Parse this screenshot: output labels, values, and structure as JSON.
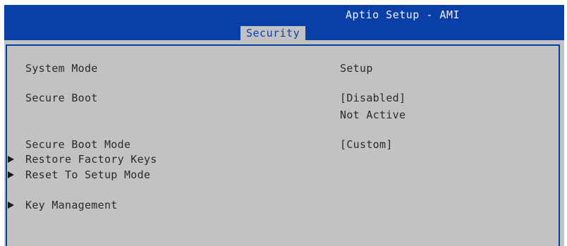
{
  "header": {
    "title": "Aptio Setup - AMI",
    "active_tab": "Security"
  },
  "settings": [
    {
      "label": "System Mode",
      "value": "Setup"
    },
    {
      "label": "Secure Boot",
      "value": "[Disabled]",
      "status": "Not Active"
    },
    {
      "label": "Secure Boot Mode",
      "value": "[Custom]"
    }
  ],
  "submenus": [
    {
      "label": "Restore Factory Keys",
      "icon": "triangle-right-icon"
    },
    {
      "label": "Reset To Setup Mode",
      "icon": "triangle-right-icon"
    },
    {
      "label": "Key Management",
      "icon": "triangle-right-icon"
    }
  ],
  "colors": {
    "header_background": "#0a3fa8",
    "panel_background": "#c2c2c2",
    "text": "#2a2a2a"
  }
}
